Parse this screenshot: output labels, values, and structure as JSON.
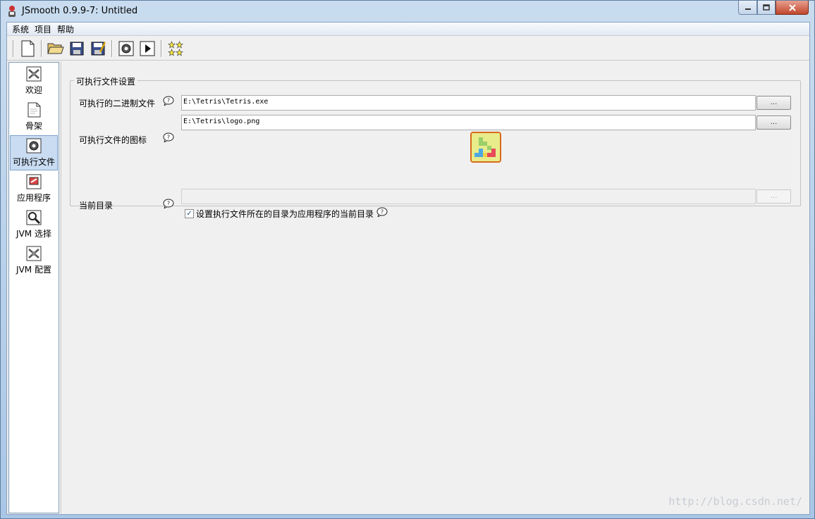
{
  "window": {
    "title": "JSmooth 0.9.9-7: Untitled"
  },
  "menu": {
    "items": [
      "系统",
      "项目",
      "帮助"
    ]
  },
  "toolbar": {
    "buttons": [
      "new-icon",
      "open-icon",
      "save-icon",
      "save-as-icon",
      "compile-icon",
      "run-icon",
      "about-icon"
    ]
  },
  "sidebar": {
    "items": [
      {
        "label": "欢迎",
        "icon": "welcome-icon"
      },
      {
        "label": "骨架",
        "icon": "skeleton-icon"
      },
      {
        "label": "可执行文件",
        "icon": "executable-icon",
        "selected": true
      },
      {
        "label": "应用程序",
        "icon": "application-icon"
      },
      {
        "label": "JVM 选择",
        "icon": "jvm-select-icon"
      },
      {
        "label": "JVM 配置",
        "icon": "jvm-config-icon"
      }
    ]
  },
  "executable_settings": {
    "group_title": "可执行文件设置",
    "binary_label": "可执行的二进制文件",
    "binary_value": "E:\\Tetris\\Tetris.exe",
    "icon_label": "可执行文件的图标",
    "icon_value": "E:\\Tetris\\logo.png",
    "current_dir_label": "当前目录",
    "current_dir_value": "",
    "checkbox_label": "设置执行文件所在的目录为应用程序的当前目录",
    "checkbox_checked": true,
    "browse_label": "..."
  },
  "watermark": "http://blog.csdn.net/"
}
